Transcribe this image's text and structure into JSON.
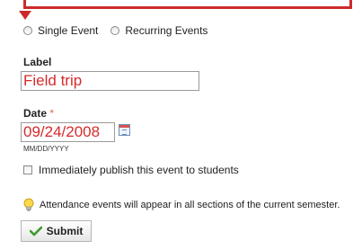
{
  "event_type": {
    "single_label": "Single Event",
    "recurring_label": "Recurring Events"
  },
  "label_field": {
    "label": "Label",
    "value": "Field trip"
  },
  "date_field": {
    "label": "Date",
    "required_marker": "*",
    "value": "09/24/2008",
    "format_hint": "MM/DD/YYYY"
  },
  "publish": {
    "label": "Immediately publish this event to students"
  },
  "info": {
    "text": "Attendance events will appear in all sections of the current semester."
  },
  "submit": {
    "label": "Submit"
  },
  "colors": {
    "annotation": "#cc2a2a",
    "input_text": "#d62b2b",
    "required": "#e06a3a",
    "success_icon": "#3f9a2f"
  },
  "icons": {
    "calendar": "calendar-icon",
    "lightbulb": "lightbulb-icon",
    "checkmark": "checkmark-icon"
  }
}
